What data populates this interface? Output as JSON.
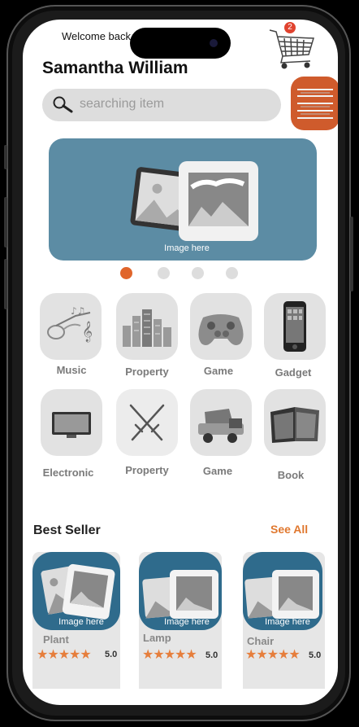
{
  "header": {
    "welcome_text": "Welcome back",
    "user_name": "Samantha William",
    "cart_count": "2"
  },
  "search": {
    "placeholder": "searching item"
  },
  "banner": {
    "caption": "Image here",
    "pages": 4,
    "active_page": 1
  },
  "categories": [
    {
      "label": "Music",
      "icon": "music-instruments-icon"
    },
    {
      "label": "Property",
      "icon": "city-buildings-icon"
    },
    {
      "label": "Game",
      "icon": "game-controller-icon"
    },
    {
      "label": "Gadget",
      "icon": "smartphone-icon"
    },
    {
      "label": "Electronic",
      "icon": "television-icon"
    },
    {
      "label": "Property",
      "icon": "crossed-swords-icon"
    },
    {
      "label": "Game",
      "icon": "toy-truck-icon"
    },
    {
      "label": "Book",
      "icon": "open-book-icon"
    }
  ],
  "best_seller": {
    "title": "Best Seller",
    "see_all": "See All",
    "items": [
      {
        "name": "Plant",
        "caption": "Image here",
        "stars": "★★★★★",
        "rating": "5.0"
      },
      {
        "name": "Lamp",
        "caption": "Image here",
        "stars": "★★★★★",
        "rating": "5.0"
      },
      {
        "name": "Chair",
        "caption": "Image here",
        "stars": "★★★★★",
        "rating": "5.0"
      }
    ]
  },
  "colors": {
    "accent": "#cf5b2c",
    "banner": "#5c8ca4",
    "card": "#2f6b8c",
    "star": "#e67e3c"
  }
}
